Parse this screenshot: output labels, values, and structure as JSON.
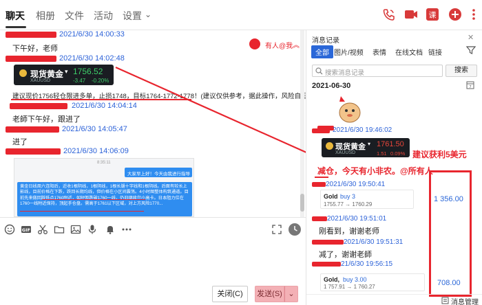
{
  "nav": {
    "tabs": [
      "聊天",
      "相册",
      "文件",
      "活动",
      "设置"
    ],
    "settings_caret": "⌄"
  },
  "chat": {
    "messages": [
      {
        "time": "2021/6/30 14:00:33",
        "text": "下午好，老师"
      },
      {
        "time": "2021/6/30 14:02:48"
      },
      {
        "time": "2021/6/30 14:04:14",
        "text": "老師下午好，跟进了"
      },
      {
        "time": "2021/6/30 14:05:47",
        "text": "进了"
      },
      {
        "time": "2021/6/30 14:06:09"
      }
    ],
    "mention_label": "有人@我",
    "gold_card": {
      "title": "现货黄金",
      "symbol": "XAUUSD",
      "price": "1756.52",
      "change": "-3.47",
      "percent": "-0.20%"
    },
    "advice": "建议现价1756轻仓限进多单，止损1748，目标1764-1772-1778！(建议仅供参考，据此操作，风险自担)",
    "screenshot_time": "8:35:11",
    "screenshot_bubble": "大家早上好！今天由我进行指导",
    "screenshot_text": "黄金日线周六连阳后，近收1根阴线，1根阴线，1根长腿十字线和1根阴线。后面有较长上影线，目前价格在下跌，跌回长期均线，但价格在小区间震荡。4小时图整体构筑通道。目前先来做回踩低点1760附近，如短暂跌破1760一线，仍旧继续尔小高卡。日本阻力位在1760一线附近保持，顶起手仓盘。需高于1761以下区域，对上方风险1770..."
  },
  "toolbar": {
    "close_label": "关闭(C)",
    "send_label": "发送(S)"
  },
  "side": {
    "title": "消息记录",
    "filters": [
      "全部",
      "图片/视频",
      "表情",
      "在线文档",
      "链接"
    ],
    "search_placeholder": "搜索消息记录",
    "search_button": "搜索",
    "date": "2021-06-30",
    "times": [
      "2021/6/30 19:46:02",
      "2021/6/30 19:50:41",
      "2021/6/30 19:51:01",
      "2021/6/30 19:51:31",
      "21/6/30 19:56:15"
    ],
    "gold_card": {
      "title": "现货黄金",
      "symbol": "XAUUSD",
      "price": "1761.50",
      "change": "1.51",
      "percent": "0.09%"
    },
    "annot_profit": "建议获利5美元",
    "annot_reduce": "减仓，今天有小非农。@所有人",
    "trade1": {
      "title": "Gold",
      "action": "buy 3",
      "prices": "1755.77 → 1760.29",
      "amount": "1 356.00"
    },
    "msg1": "刚看到，谢谢老师",
    "msg2": "减了，谢谢老師",
    "trade2": {
      "title": "Gold,",
      "action": "buy 3.00",
      "prices": "1 757.91 → 1 760.27",
      "amount": "708.00"
    },
    "footer": "消息管理"
  }
}
